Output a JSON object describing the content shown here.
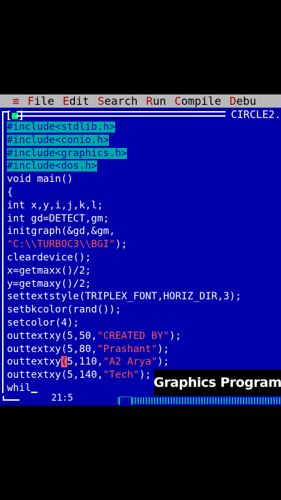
{
  "menu": {
    "system": "≡",
    "items": [
      {
        "hot": "F",
        "rest": "ile"
      },
      {
        "hot": "E",
        "rest": "dit"
      },
      {
        "hot": "S",
        "rest": "earch"
      },
      {
        "hot": "R",
        "rest": "un"
      },
      {
        "hot": "C",
        "rest": "ompile"
      },
      {
        "hot": "D",
        "rest": "ebu"
      }
    ]
  },
  "window": {
    "close_left": "[",
    "close_mark": "■",
    "close_right": "]",
    "filename": "CIRCLE2."
  },
  "code": {
    "l1": "#include<stdlib.h>",
    "l2": "#include<conio.h>",
    "l3": "#include<graphics.h>",
    "l4": "#include<dos.h>",
    "l5": "void main()",
    "l6": "{",
    "l7": "int x,y,i,j,k,l;",
    "l8": "int gd=DETECT,gm;",
    "l9": "initgraph(&gd,&gm,",
    "l10": "\"C:\\\\TURBOC3\\\\BGI\"",
    "l10b": ");",
    "l11": "cleardevice();",
    "l12": "x=getmaxx()/2;",
    "l13": "y=getmaxy()/2;",
    "l14": "settextstyle(TRIPLEX_FONT,HORIZ_DIR,3);",
    "l15": "setbkcolor(rand());",
    "l16": "setcolor(4);",
    "l17a": "outtextxy(5,50,",
    "l17s": "\"CREATED BY\"",
    "l17b": ");",
    "l18a": "outtextxy(5,80,",
    "l18s": "\"Prashant\"",
    "l18b": ");",
    "l19a": "outtextxy",
    "l19c": "(",
    "l19b": "5,110,",
    "l19s": "\"A2 Arya\"",
    "l19e": ");",
    "l20a": "outtextxy(5,140,",
    "l20s": "\"Tech\"",
    "l20b": ");",
    "l21": "whil"
  },
  "status": {
    "position": "21:5"
  },
  "overlay": {
    "caption": "Graphics Program"
  }
}
